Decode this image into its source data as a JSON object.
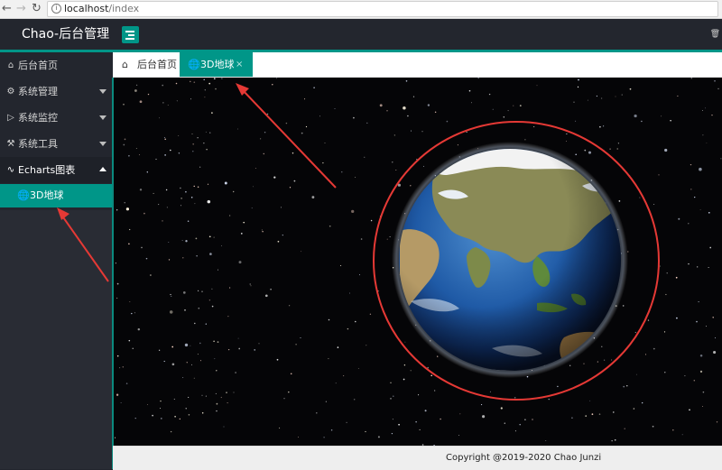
{
  "browser": {
    "url_host": "localhost",
    "url_path": "/index",
    "info_icon": "info-icon"
  },
  "header": {
    "title": "Chao-后台管理",
    "menu_icon": "menu-toggle-icon",
    "right_icon": "trash-icon"
  },
  "sidebar": {
    "items": [
      {
        "label": "后台首页",
        "icon": "home-icon"
      },
      {
        "label": "系统管理",
        "icon": "gear-icon"
      },
      {
        "label": "系统监控",
        "icon": "monitor-icon"
      },
      {
        "label": "系统工具",
        "icon": "tools-icon"
      },
      {
        "label": "Echarts图表",
        "icon": "chart-pulse-icon"
      }
    ],
    "sub_item": {
      "label": "3D地球",
      "icon": "globe-icon"
    }
  },
  "tabs": [
    {
      "label": "后台首页",
      "icon": "home-icon"
    },
    {
      "label": "3D地球",
      "icon": "globe-icon",
      "close": "×"
    }
  ],
  "footer": {
    "copyright": "Copyright @2019-2020 Chao Junzi"
  },
  "colors": {
    "accent": "#009688",
    "header_bg": "#23262e",
    "annotation_red": "#e53935"
  }
}
